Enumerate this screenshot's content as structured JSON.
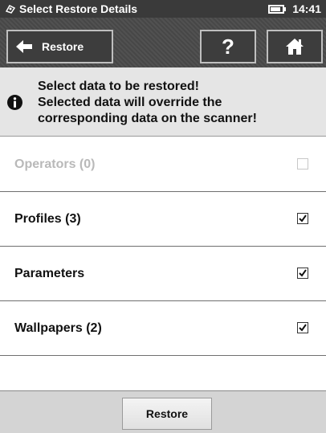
{
  "status_bar": {
    "title": "Select Restore Details",
    "clock": "14:41",
    "app_icon": "scanner-app-icon",
    "battery_icon": "battery-icon"
  },
  "toolbar": {
    "back_label": "Restore",
    "back_icon": "arrow-left-icon",
    "help_label": "?",
    "home_icon": "home-icon"
  },
  "info": {
    "icon": "info-icon",
    "lines": [
      "Select data to be restored!",
      "Selected data will override the",
      "corresponding data on the scanner!"
    ]
  },
  "items": [
    {
      "label": "Operators (0)",
      "checked": false,
      "enabled": false
    },
    {
      "label": "Profiles (3)",
      "checked": true,
      "enabled": true
    },
    {
      "label": "Parameters",
      "checked": true,
      "enabled": true
    },
    {
      "label": "Wallpapers (2)",
      "checked": true,
      "enabled": true
    }
  ],
  "footer": {
    "restore_label": "Restore"
  }
}
